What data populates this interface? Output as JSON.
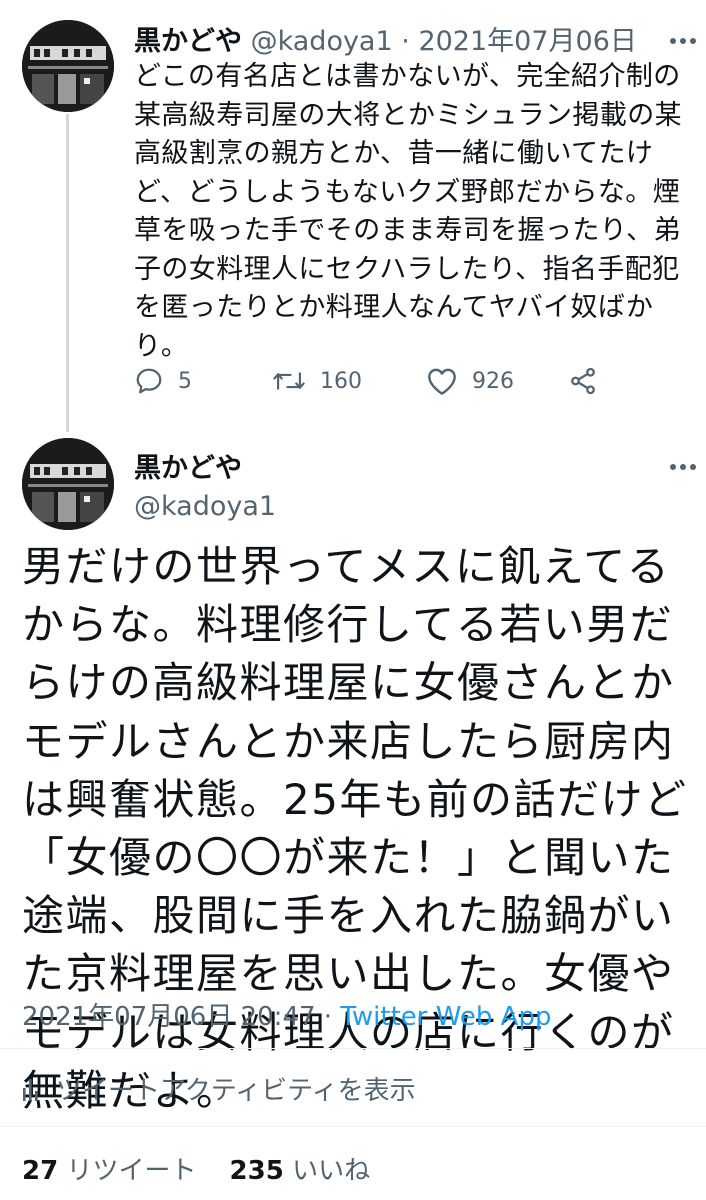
{
  "reply_tweet": {
    "display_name": "黒かどや",
    "handle": "@kadoya1",
    "separator": "·",
    "date": "2021年07月06日",
    "text": "どこの有名店とは書かないが、完全紹介制の某高級寿司屋の大将とかミシュラン掲載の某高級割烹の親方とか、昔一緒に働いてたけど、どうしようもないクズ野郎だからな。煙草を吸った手でそのまま寿司を握ったり、弟子の女料理人にセクハラしたり、指名手配犯を匿ったりとか料理人なんてヤバイ奴ばかり。",
    "actions": {
      "reply_count": "5",
      "retweet_count": "160",
      "like_count": "926"
    }
  },
  "main_tweet": {
    "display_name": "黒かどや",
    "handle": "@kadoya1",
    "text": "男だけの世界ってメスに飢えてるからな。料理修行してる若い男だらけの高級料理屋に女優さんとかモデルさんとか来店したら厨房内は興奮状態。25年も前の話だけど「女優の〇〇が来た！」と聞いた途端、股間に手を入れた脇鍋がいた京料理屋を思い出した。女優やモデルは女料理人の店に行くのが無難だよ。",
    "timestamp": "2021年07月06日 20:47",
    "separator": "·",
    "source_app": "Twitter Web App",
    "activity_label": "ツイートアクティビティを表示",
    "retweet_count": "27",
    "retweet_label": "リツイート",
    "like_count": "235",
    "like_label": "いいね"
  },
  "icons": [
    "avatar",
    "more-icon",
    "reply-icon",
    "retweet-icon",
    "like-icon",
    "share-icon",
    "analytics-icon"
  ],
  "colors": {
    "text": "#0f1419",
    "muted": "#536471",
    "link": "#1d9bf0",
    "thread_line": "#cfd9de",
    "divider": "#eff3f4"
  }
}
